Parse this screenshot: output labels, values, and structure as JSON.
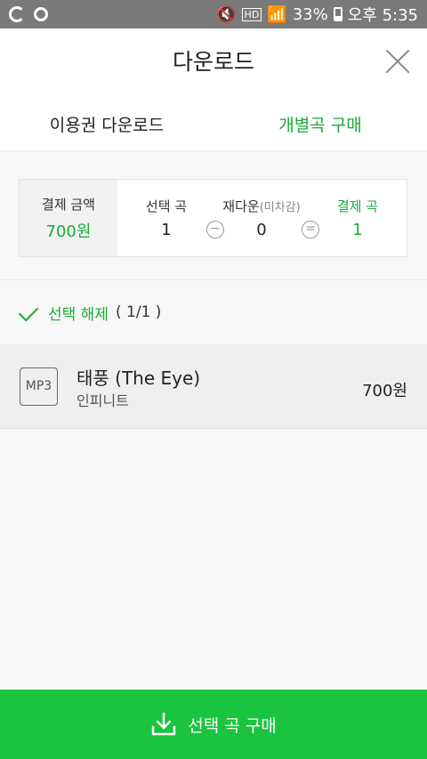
{
  "status_bar": {
    "battery": "33%",
    "time_label": "오후 5:35",
    "icons": [
      "app-g-icon",
      "app-o-icon",
      "mute-icon",
      "hd-icon",
      "wifi-icon",
      "signal-icon",
      "battery-icon"
    ]
  },
  "header": {
    "title": "다운로드"
  },
  "tabs": [
    {
      "label": "이용권 다운로드",
      "active": false
    },
    {
      "label": "개별곡 구매",
      "active": true
    }
  ],
  "summary": {
    "payment_label": "결제 금액",
    "payment_value": "700원",
    "selected_label": "선택 곡",
    "selected_value": "1",
    "minus_symbol": "−",
    "redownload_label": "재다운",
    "redownload_sub": "(미차감)",
    "redownload_value": "0",
    "equals_symbol": "=",
    "pay_songs_label": "결제 곡",
    "pay_songs_value": "1"
  },
  "selection": {
    "label": "선택 해제",
    "count": "( 1/1 )"
  },
  "songs": [
    {
      "format": "MP3",
      "title": "태풍 (The Eye)",
      "artist": "인피니트",
      "price": "700원"
    }
  ],
  "buy_button": {
    "label": "선택 곡 구매"
  },
  "colors": {
    "accent": "#1aaa38",
    "buy_bar": "#1bc43f"
  }
}
